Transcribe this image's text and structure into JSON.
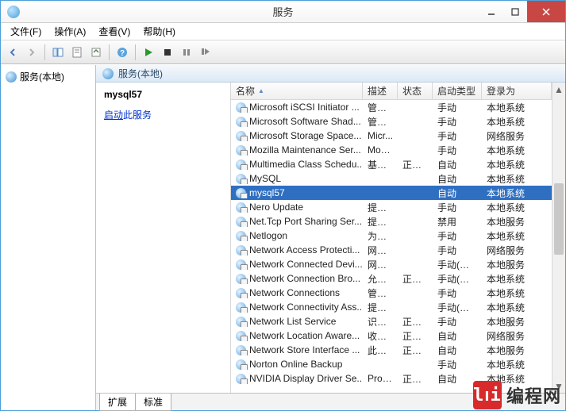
{
  "window": {
    "title": "服务"
  },
  "menu": {
    "file": "文件(F)",
    "action": "操作(A)",
    "view": "查看(V)",
    "help": "帮助(H)"
  },
  "tree": {
    "root": "服务(本地)"
  },
  "panel": {
    "header": "服务(本地)"
  },
  "detail": {
    "name": "mysql57",
    "startPrefix": "启动",
    "startSuffix": "此服务"
  },
  "columns": {
    "name": "名称",
    "desc": "描述",
    "status": "状态",
    "startup": "启动类型",
    "logon": "登录为"
  },
  "rows": [
    {
      "name": "Microsoft iSCSI Initiator ...",
      "desc": "管理...",
      "status": "",
      "startup": "手动",
      "logon": "本地系统"
    },
    {
      "name": "Microsoft Software Shad...",
      "desc": "管理...",
      "status": "",
      "startup": "手动",
      "logon": "本地系统"
    },
    {
      "name": "Microsoft Storage Space...",
      "desc": "Micr...",
      "status": "",
      "startup": "手动",
      "logon": "网络服务"
    },
    {
      "name": "Mozilla Maintenance Ser...",
      "desc": "Moz...",
      "status": "",
      "startup": "手动",
      "logon": "本地系统"
    },
    {
      "name": "Multimedia Class Schedu...",
      "desc": "基于 ...",
      "status": "正在...",
      "startup": "自动",
      "logon": "本地系统"
    },
    {
      "name": "MySQL",
      "desc": "",
      "status": "",
      "startup": "自动",
      "logon": "本地系统"
    },
    {
      "name": "mysql57",
      "desc": "",
      "status": "",
      "startup": "自动",
      "logon": "本地系统",
      "selected": true
    },
    {
      "name": "Nero Update",
      "desc": "提供...",
      "status": "",
      "startup": "手动",
      "logon": "本地系统"
    },
    {
      "name": "Net.Tcp Port Sharing Ser...",
      "desc": "提供...",
      "status": "",
      "startup": "禁用",
      "logon": "本地服务"
    },
    {
      "name": "Netlogon",
      "desc": "为用...",
      "status": "",
      "startup": "手动",
      "logon": "本地系统"
    },
    {
      "name": "Network Access Protecti...",
      "desc": "网络...",
      "status": "",
      "startup": "手动",
      "logon": "网络服务"
    },
    {
      "name": "Network Connected Devi...",
      "desc": "网络...",
      "status": "",
      "startup": "手动(触发...",
      "logon": "本地服务"
    },
    {
      "name": "Network Connection Bro...",
      "desc": "允许 ...",
      "status": "正在...",
      "startup": "手动(触发...",
      "logon": "本地系统"
    },
    {
      "name": "Network Connections",
      "desc": "管理...",
      "status": "",
      "startup": "手动",
      "logon": "本地系统"
    },
    {
      "name": "Network Connectivity Ass...",
      "desc": "提供 ...",
      "status": "",
      "startup": "手动(触发...",
      "logon": "本地系统"
    },
    {
      "name": "Network List Service",
      "desc": "识别...",
      "status": "正在...",
      "startup": "手动",
      "logon": "本地服务"
    },
    {
      "name": "Network Location Aware...",
      "desc": "收集...",
      "status": "正在...",
      "startup": "自动",
      "logon": "网络服务"
    },
    {
      "name": "Network Store Interface ...",
      "desc": "此服...",
      "status": "正在...",
      "startup": "自动",
      "logon": "本地服务"
    },
    {
      "name": "Norton Online Backup",
      "desc": "",
      "status": "",
      "startup": "手动",
      "logon": "本地系统"
    },
    {
      "name": "NVIDIA Display Driver Se...",
      "desc": "Prov...",
      "status": "正在...",
      "startup": "自动",
      "logon": "本地系统"
    }
  ],
  "tabs": {
    "extended": "扩展",
    "standard": "标准"
  },
  "watermark": "编程网"
}
